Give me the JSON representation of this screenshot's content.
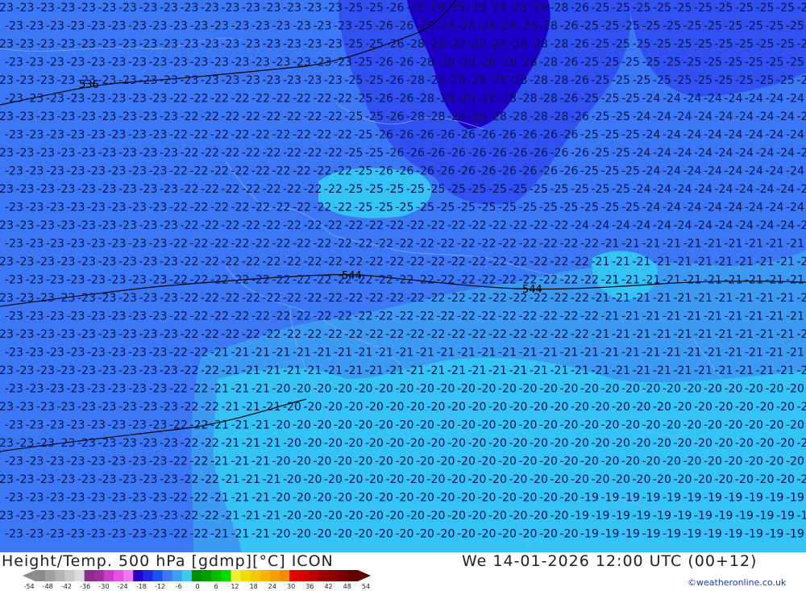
{
  "footer": {
    "title": "Height/Temp. 500 hPa [gdmp][°C] ICON",
    "datetime": "We 14-01-2026 12:00 UTC (00+12)",
    "credit": "©weatheronline.co.uk"
  },
  "contours": {
    "height_labels": [
      "536",
      "544",
      "544"
    ]
  },
  "temperature_regions": [
    {
      "range": "< -28",
      "color": "#1f00c8"
    },
    {
      "range": "-28 to -24",
      "color": "#3050f0"
    },
    {
      "range": "-24 to -22",
      "color": "#3c78f5"
    },
    {
      "range": "-22 to -21",
      "color": "#3c9af2"
    },
    {
      "range": "> -21",
      "color": "#35c3f5"
    }
  ],
  "temperature_labels": [
    {
      "value": "-23"
    },
    {
      "value": "-22"
    },
    {
      "value": "-21"
    },
    {
      "value": "-20"
    },
    {
      "value": "-19"
    },
    {
      "value": "-24"
    },
    {
      "value": "-25"
    },
    {
      "value": "-26"
    },
    {
      "value": "-27"
    },
    {
      "value": "-28"
    }
  ],
  "legend": {
    "ticks": [
      "-54",
      "-48",
      "-42",
      "-36",
      "-30",
      "-24",
      "-18",
      "-12",
      "-6",
      "0",
      "6",
      "12",
      "18",
      "24",
      "30",
      "36",
      "42",
      "48",
      "54"
    ],
    "colors": [
      "#8c8c8c",
      "#a0a0a0",
      "#b4b4b4",
      "#c8c8c8",
      "#dcdcdc",
      "#8c2d8c",
      "#a02da0",
      "#c83cc8",
      "#e650e6",
      "#f078f0",
      "#2800c8",
      "#1e28e6",
      "#1e50f0",
      "#3c78f5",
      "#3ca0f5",
      "#3cc8f5",
      "#008c00",
      "#00a000",
      "#00be00",
      "#00dc00",
      "#f0f032",
      "#f0dc00",
      "#f5c800",
      "#f5b400",
      "#f5a000",
      "#f58c00",
      "#e60000",
      "#d20000",
      "#be0000",
      "#a00000",
      "#8c0000",
      "#780000",
      "#640000"
    ]
  }
}
